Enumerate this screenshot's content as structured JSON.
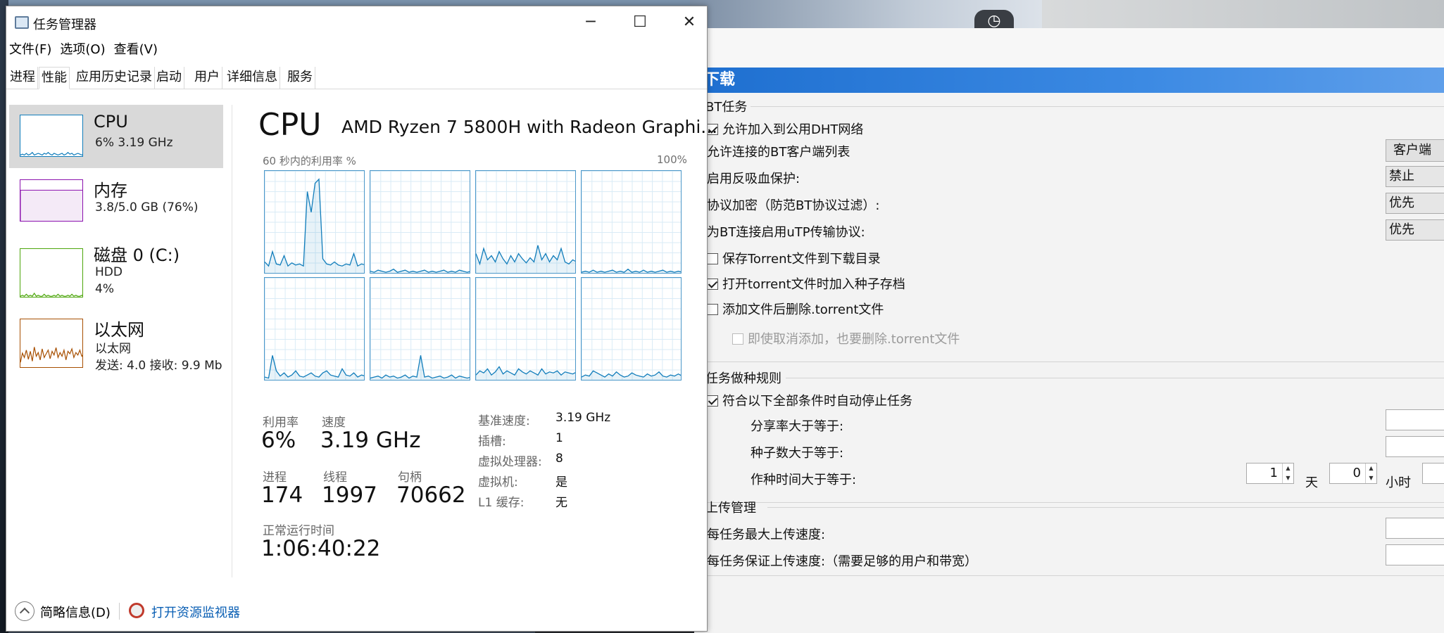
{
  "taskmgr": {
    "title": "任务管理器",
    "window_buttons": {
      "minimize": "─",
      "maximize": "☐",
      "close": "✕"
    },
    "menu": [
      "文件(F)",
      "选项(O)",
      "查看(V)"
    ],
    "tabs": [
      "进程",
      "性能",
      "应用历史记录",
      "启动",
      "用户",
      "详细信息",
      "服务"
    ],
    "active_tab": "性能",
    "sidebar": [
      {
        "name": "CPU",
        "line1": "6%  3.19 GHz",
        "line2": "",
        "color": "#117dbb"
      },
      {
        "name": "内存",
        "line1": "3.8/5.0 GB (76%)",
        "line2": "",
        "color": "#8b12ae"
      },
      {
        "name": "磁盘 0 (C:)",
        "line1": "HDD",
        "line2": "4%",
        "color": "#4da60c"
      },
      {
        "name": "以太网",
        "line1": "以太网",
        "line2": "发送: 4.0  接收: 9.9 Mb",
        "color": "#a74f01"
      }
    ],
    "cpu": {
      "title": "CPU",
      "model": "AMD Ryzen 7 5800H with Radeon Graphi...",
      "graph_label": "60 秒内的利用率 %",
      "graph_max": "100%",
      "stats": {
        "util_label": "利用率",
        "util": "6%",
        "speed_label": "速度",
        "speed": "3.19 GHz",
        "proc_label": "进程",
        "proc": "174",
        "thread_label": "线程",
        "thread": "1997",
        "handle_label": "句柄",
        "handle": "70662",
        "uptime_label": "正常运行时间",
        "uptime": "1:06:40:22"
      },
      "props": [
        {
          "k": "基准速度:",
          "v": "3.19 GHz"
        },
        {
          "k": "插槽:",
          "v": "1"
        },
        {
          "k": "虚拟处理器:",
          "v": "8"
        },
        {
          "k": "虚拟机:",
          "v": "是"
        },
        {
          "k": "L1 缓存:",
          "v": "无"
        }
      ]
    },
    "footer": {
      "brief": "简略信息(D)",
      "monitor": "打开资源监视器"
    }
  },
  "download": {
    "header": "下载",
    "bt_section": "BT任务",
    "dht": "允许加入到公用DHT网络",
    "client_list": "允许连接的BT客户端列表",
    "client_btn": "客户端",
    "antileech": "启用反吸血保护:",
    "antileech_val": "禁止",
    "encrypt": "协议加密（防范BT协议过滤）:",
    "encrypt_val": "优先",
    "utp": "为BT连接启用uTP传输协议:",
    "utp_val": "优先",
    "save_torrent": "保存Torrent文件到下载目录",
    "add_seed": "打开torrent文件时加入种子存档",
    "delete_torrent": "添加文件后删除.torrent文件",
    "cancel_delete": "即使取消添加，也要删除.torrent文件",
    "seed_section": "任务做种规则",
    "auto_stop": "符合以下全部条件时自动停止任务",
    "share_ratio": "分享率大于等于:",
    "seeds": "种子数大于等于:",
    "seed_time": "作种时间大于等于:",
    "days_val": "1",
    "days_unit": "天",
    "hours_val": "0",
    "hours_unit": "小时",
    "upload_section": "上传管理",
    "max_up": "每任务最大上传速度:",
    "guarantee_up": "每任务保证上传速度:（需要足够的用户和带宽）"
  },
  "desktop": {
    "clock_icon": "clock-icon"
  },
  "chart_data": {
    "type": "line",
    "title": "60 秒内的利用率 %",
    "ylim": [
      0,
      100
    ],
    "series": [
      {
        "values": [
          12,
          8,
          22,
          10,
          9,
          18,
          8,
          11,
          9,
          10,
          8,
          80,
          60,
          88,
          92,
          15,
          10,
          9,
          12,
          9,
          8,
          10,
          9,
          20,
          8,
          10,
          9
        ]
      },
      {
        "values": [
          3,
          2,
          4,
          3,
          2,
          3,
          5,
          2,
          3,
          4,
          2,
          3,
          2,
          3,
          4,
          2,
          3,
          2,
          3,
          4,
          2,
          3,
          2,
          4,
          3,
          2,
          3
        ]
      },
      {
        "values": [
          20,
          10,
          25,
          14,
          18,
          12,
          22,
          15,
          10,
          18,
          12,
          20,
          15,
          11,
          16,
          12,
          28,
          14,
          20,
          12,
          18,
          14,
          25,
          12,
          10,
          14,
          12
        ]
      },
      {
        "values": [
          2,
          3,
          2,
          4,
          2,
          3,
          2,
          3,
          4,
          2,
          3,
          2,
          5,
          2,
          3,
          2,
          4,
          2,
          3,
          2,
          3,
          4,
          2,
          3,
          2,
          3,
          2
        ]
      },
      {
        "values": [
          4,
          3,
          25,
          10,
          5,
          8,
          4,
          6,
          10,
          5,
          4,
          6,
          8,
          5,
          4,
          8,
          10,
          6,
          5,
          4,
          12,
          6,
          5,
          8,
          4,
          6,
          5
        ]
      },
      {
        "values": [
          3,
          4,
          5,
          3,
          6,
          4,
          5,
          3,
          4,
          6,
          3,
          5,
          4,
          25,
          4,
          5,
          3,
          4,
          5,
          3,
          4,
          6,
          3,
          5,
          4,
          3,
          4
        ]
      },
      {
        "values": [
          6,
          10,
          8,
          12,
          6,
          9,
          14,
          7,
          10,
          8,
          6,
          12,
          9,
          7,
          10,
          8,
          6,
          12,
          7,
          9,
          8,
          10,
          6,
          9,
          8,
          7,
          9
        ]
      },
      {
        "values": [
          4,
          6,
          5,
          10,
          8,
          6,
          4,
          7,
          5,
          9,
          6,
          4,
          5,
          8,
          6,
          5,
          4,
          7,
          5,
          6,
          9,
          5,
          4,
          6,
          5,
          7,
          5
        ]
      }
    ],
    "thumbs": {
      "cpu": [
        3,
        4,
        3,
        5,
        3,
        4,
        6,
        3,
        4,
        5,
        4,
        3,
        5,
        4,
        6,
        4,
        3,
        5,
        4,
        3,
        4,
        5,
        3,
        4,
        6,
        4,
        5,
        3,
        4,
        5,
        4,
        3,
        4
      ],
      "memory": [
        0,
        0,
        0,
        0,
        0,
        0,
        0,
        0,
        0,
        0,
        0,
        0,
        0,
        0,
        0,
        0,
        0,
        0,
        0,
        0,
        0,
        0,
        0,
        0,
        0,
        0,
        0,
        0,
        0,
        0,
        0,
        0,
        0
      ],
      "disk": [
        2,
        3,
        2,
        4,
        2,
        3,
        2,
        5,
        2,
        3,
        2,
        2,
        4,
        2,
        3,
        2,
        2,
        3,
        2,
        4,
        2,
        3,
        2,
        2,
        3,
        2,
        4,
        2,
        3,
        2,
        2,
        3,
        2
      ],
      "net": [
        10,
        25,
        18,
        30,
        15,
        28,
        12,
        35,
        20,
        26,
        14,
        32,
        18,
        24,
        30,
        16,
        28,
        22,
        34,
        18,
        26,
        20,
        30,
        14,
        28,
        24,
        32,
        18,
        26,
        22,
        30,
        20,
        24
      ]
    }
  }
}
